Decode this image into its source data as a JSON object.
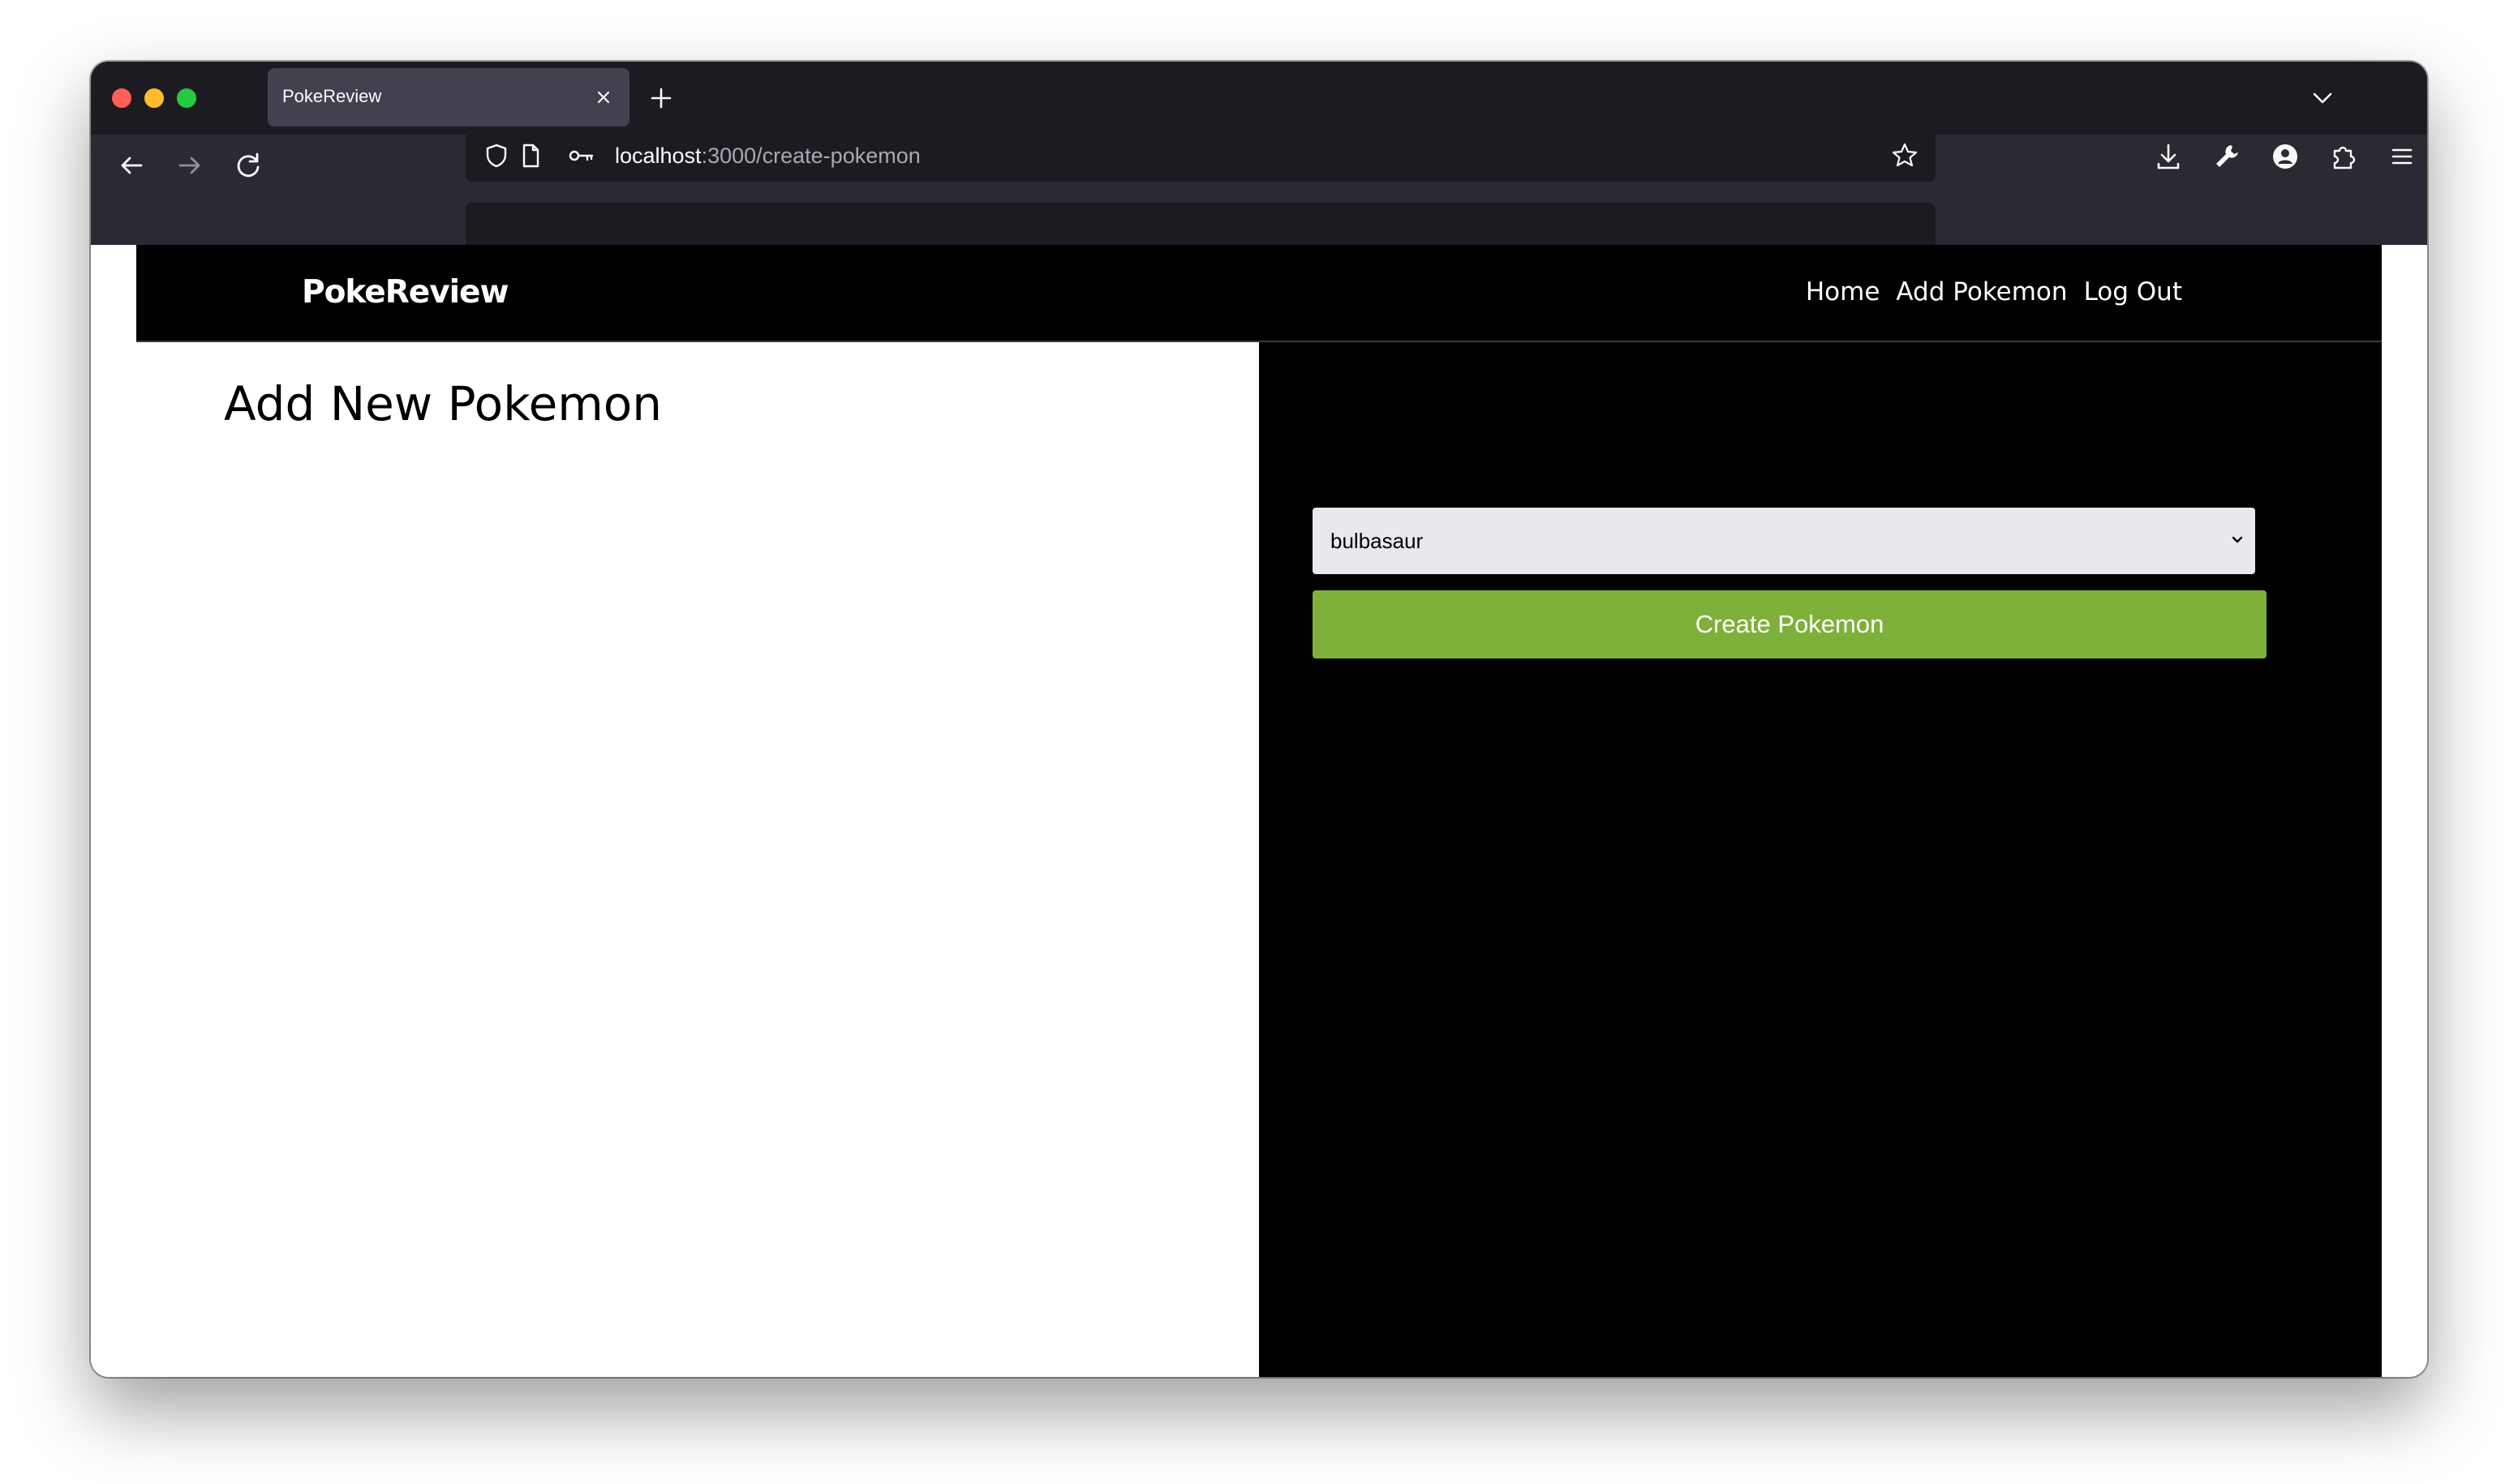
{
  "browser": {
    "tab": {
      "title": "PokeReview",
      "close_icon": "close-icon"
    },
    "new_tab_icon": "plus-icon",
    "tab_list_icon": "chevron-down-icon",
    "nav": {
      "back_icon": "arrow-left-icon",
      "forward_icon": "arrow-right-icon",
      "reload_icon": "reload-icon"
    },
    "url": {
      "host": "localhost",
      "rest": ":3000/create-pokemon"
    },
    "toolbar_icons": [
      "download-icon",
      "wrench-icon",
      "account-icon",
      "extensions-icon",
      "menu-icon"
    ],
    "colors": {
      "titlebar": "#1c1b22",
      "toolbar": "#2b2a33",
      "tab_active": "#42414d"
    }
  },
  "app": {
    "brand": "PokeReview",
    "nav_links": [
      "Home",
      "Add Pokemon",
      "Log Out"
    ],
    "page_title": "Add New Pokemon",
    "form": {
      "pokemon_select_value": "bulbasaur",
      "submit_label": "Create Pokemon"
    },
    "colors": {
      "header_bg": "#000000",
      "panel_bg": "#000000",
      "button_bg": "#7fb03a"
    }
  }
}
